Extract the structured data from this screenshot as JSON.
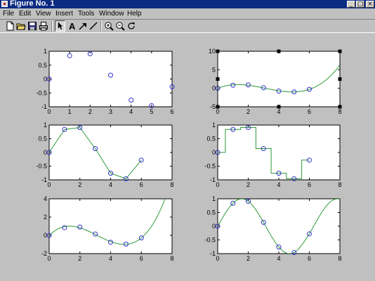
{
  "window": {
    "title": "Figure No. 1",
    "buttons": {
      "minimize": "_",
      "maximize": "□",
      "close": "×"
    }
  },
  "menu": [
    "File",
    "Edit",
    "View",
    "Insert",
    "Tools",
    "Window",
    "Help"
  ],
  "toolbar": {
    "icons": [
      "new-file-icon",
      "open-folder-icon",
      "save-icon",
      "print-icon",
      "arrow-pointer-icon",
      "text-icon",
      "arrow-icon",
      "line-icon",
      "zoom-in-icon",
      "zoom-out-icon",
      "rotate-icon"
    ]
  },
  "colors": {
    "marker": "#3333cc",
    "line": "#2e9a3a",
    "titlebar": "#0b2a82",
    "background": "#c0c0c0"
  },
  "chart_data": [
    {
      "type": "scatter",
      "xlim": [
        0,
        6
      ],
      "ylim": [
        -1,
        1
      ],
      "xticks": [
        "0",
        "1",
        "2",
        "3",
        "4",
        "5",
        "6"
      ],
      "yticks": [
        "1",
        "0.5",
        "0",
        "-0.5",
        "-1"
      ],
      "points": {
        "x": [
          0,
          1,
          2,
          3,
          4,
          5,
          6
        ],
        "y": [
          0,
          0.84,
          0.91,
          0.14,
          -0.76,
          -0.96,
          -0.28
        ]
      },
      "curve": "none"
    },
    {
      "type": "line",
      "xlim": [
        0,
        8
      ],
      "ylim": [
        -5,
        10
      ],
      "xticks": [
        "0",
        "2",
        "4",
        "6",
        "8"
      ],
      "yticks": [
        "10",
        "5",
        "0",
        "-5"
      ],
      "points": {
        "x": [
          0,
          1,
          2,
          3,
          4,
          5,
          6
        ],
        "y": [
          0,
          0.84,
          0.91,
          0.14,
          -0.76,
          -0.96,
          -0.28
        ]
      },
      "curve": "cubic",
      "curve_x_range": [
        0,
        8
      ],
      "selected": true
    },
    {
      "type": "line",
      "xlim": [
        0,
        8
      ],
      "ylim": [
        -1,
        1
      ],
      "xticks": [
        "0",
        "2",
        "4",
        "6",
        "8"
      ],
      "yticks": [
        "1",
        "0.5",
        "0",
        "-0.5",
        "-1"
      ],
      "points": {
        "x": [
          0,
          1,
          2,
          3,
          4,
          5,
          6
        ],
        "y": [
          0,
          0.84,
          0.91,
          0.14,
          -0.76,
          -0.96,
          -0.28
        ]
      },
      "curve": "linear",
      "curve_x_range": [
        0,
        6
      ]
    },
    {
      "type": "line",
      "xlim": [
        0,
        8
      ],
      "ylim": [
        -1,
        1
      ],
      "xticks": [
        "0",
        "2",
        "4",
        "6",
        "8"
      ],
      "yticks": [
        "1",
        "0.5",
        "0",
        "-0.5",
        "-1"
      ],
      "points": {
        "x": [
          0,
          1,
          2,
          3,
          4,
          5,
          6
        ],
        "y": [
          0,
          0.84,
          0.91,
          0.14,
          -0.76,
          -0.96,
          -0.28
        ]
      },
      "curve": "nearest",
      "curve_x_range": [
        0,
        6
      ]
    },
    {
      "type": "line",
      "xlim": [
        0,
        8
      ],
      "ylim": [
        -2,
        4
      ],
      "xticks": [
        "0",
        "2",
        "4",
        "6",
        "8"
      ],
      "yticks": [
        "4",
        "2",
        "0",
        "-2"
      ],
      "points": {
        "x": [
          0,
          1,
          2,
          3,
          4,
          5,
          6
        ],
        "y": [
          0,
          0.84,
          0.91,
          0.14,
          -0.76,
          -0.96,
          -0.28
        ]
      },
      "curve": "cubic",
      "curve_x_range": [
        0,
        8
      ]
    },
    {
      "type": "line",
      "xlim": [
        0,
        8
      ],
      "ylim": [
        -1,
        1
      ],
      "xticks": [
        "0",
        "2",
        "4",
        "6",
        "8"
      ],
      "yticks": [
        "1",
        "0.5",
        "0",
        "-0.5",
        "-1"
      ],
      "points": {
        "x": [
          0,
          1,
          2,
          3,
          4,
          5,
          6
        ],
        "y": [
          0,
          0.84,
          0.91,
          0.14,
          -0.76,
          -0.96,
          -0.28
        ]
      },
      "curve": "spline",
      "curve_x_range": [
        0,
        8
      ]
    }
  ]
}
